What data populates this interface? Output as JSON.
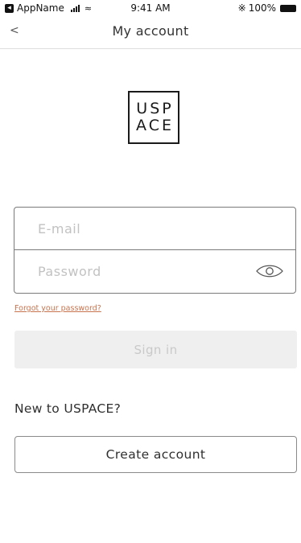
{
  "status_bar": {
    "app_name": "AppName",
    "time": "9:41 AM",
    "battery": "100%"
  },
  "nav": {
    "back_label": "<",
    "title": "My account"
  },
  "logo": {
    "line1": "USP",
    "line2": "ACE"
  },
  "form": {
    "email_placeholder": "E-mail",
    "email_value": "",
    "password_placeholder": "Password",
    "password_value": "",
    "forgot_label": "Forgot your password?",
    "sign_in_label": "Sign in"
  },
  "signup": {
    "prompt": "New to USPACE?",
    "create_label": "Create account"
  },
  "colors": {
    "accent_link": "#c8744f",
    "disabled_button_bg": "#efefef"
  }
}
